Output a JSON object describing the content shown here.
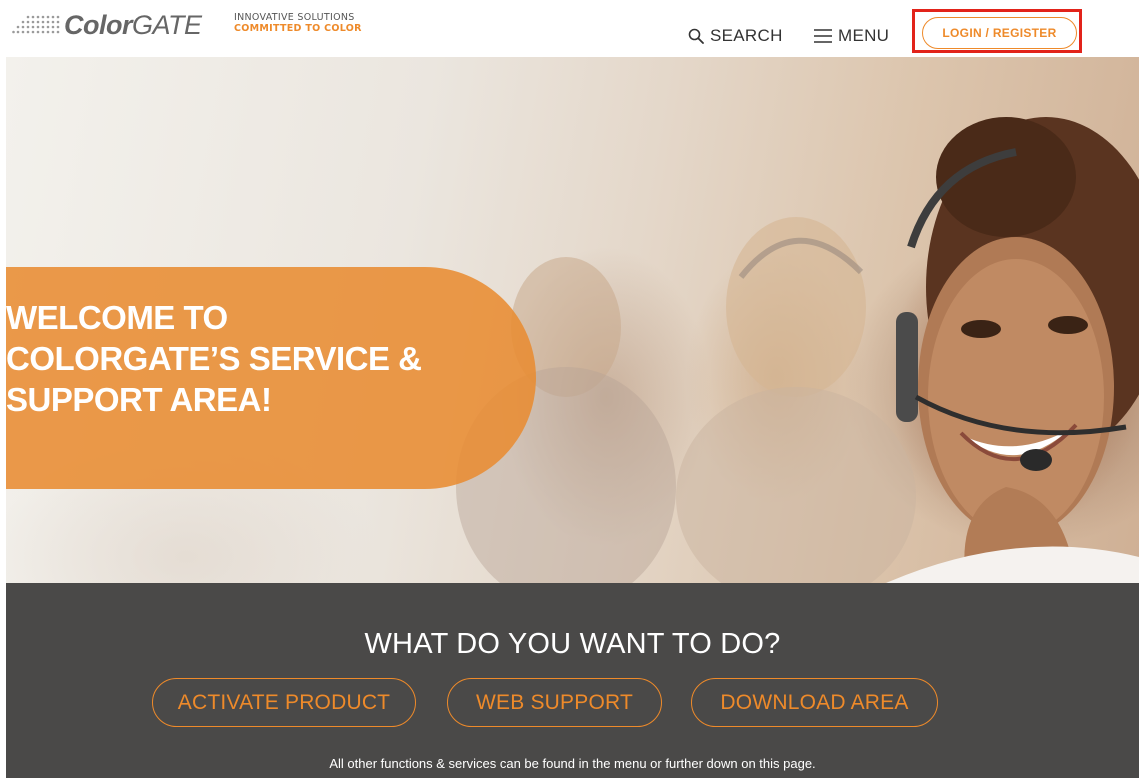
{
  "header": {
    "logo": {
      "part1": "Color",
      "part2": "GATE"
    },
    "tagline": {
      "line1": "INNOVATIVE SOLUTIONS",
      "line2": "COMMITTED TO COLOR"
    },
    "search_label": "SEARCH",
    "menu_label": "MENU",
    "login_label": "LOGIN / REGISTER"
  },
  "hero": {
    "welcome_lines": [
      "WELCOME TO",
      "COLORGATE’S SERVICE &",
      "SUPPORT AREA!"
    ]
  },
  "actions": {
    "title": "WHAT DO YOU WANT TO DO?",
    "buttons": [
      "ACTIVATE PRODUCT",
      "WEB SUPPORT",
      "DOWNLOAD AREA"
    ],
    "note": "All other functions & services can be found in the menu or further down on this page."
  },
  "colors": {
    "accent": "#ee8a2a",
    "highlight_frame": "#e2231a",
    "action_strip_bg": "#4a4948",
    "welcome_panel": "#e88c32"
  },
  "icons": {
    "search": "search-icon",
    "menu": "hamburger-icon"
  }
}
